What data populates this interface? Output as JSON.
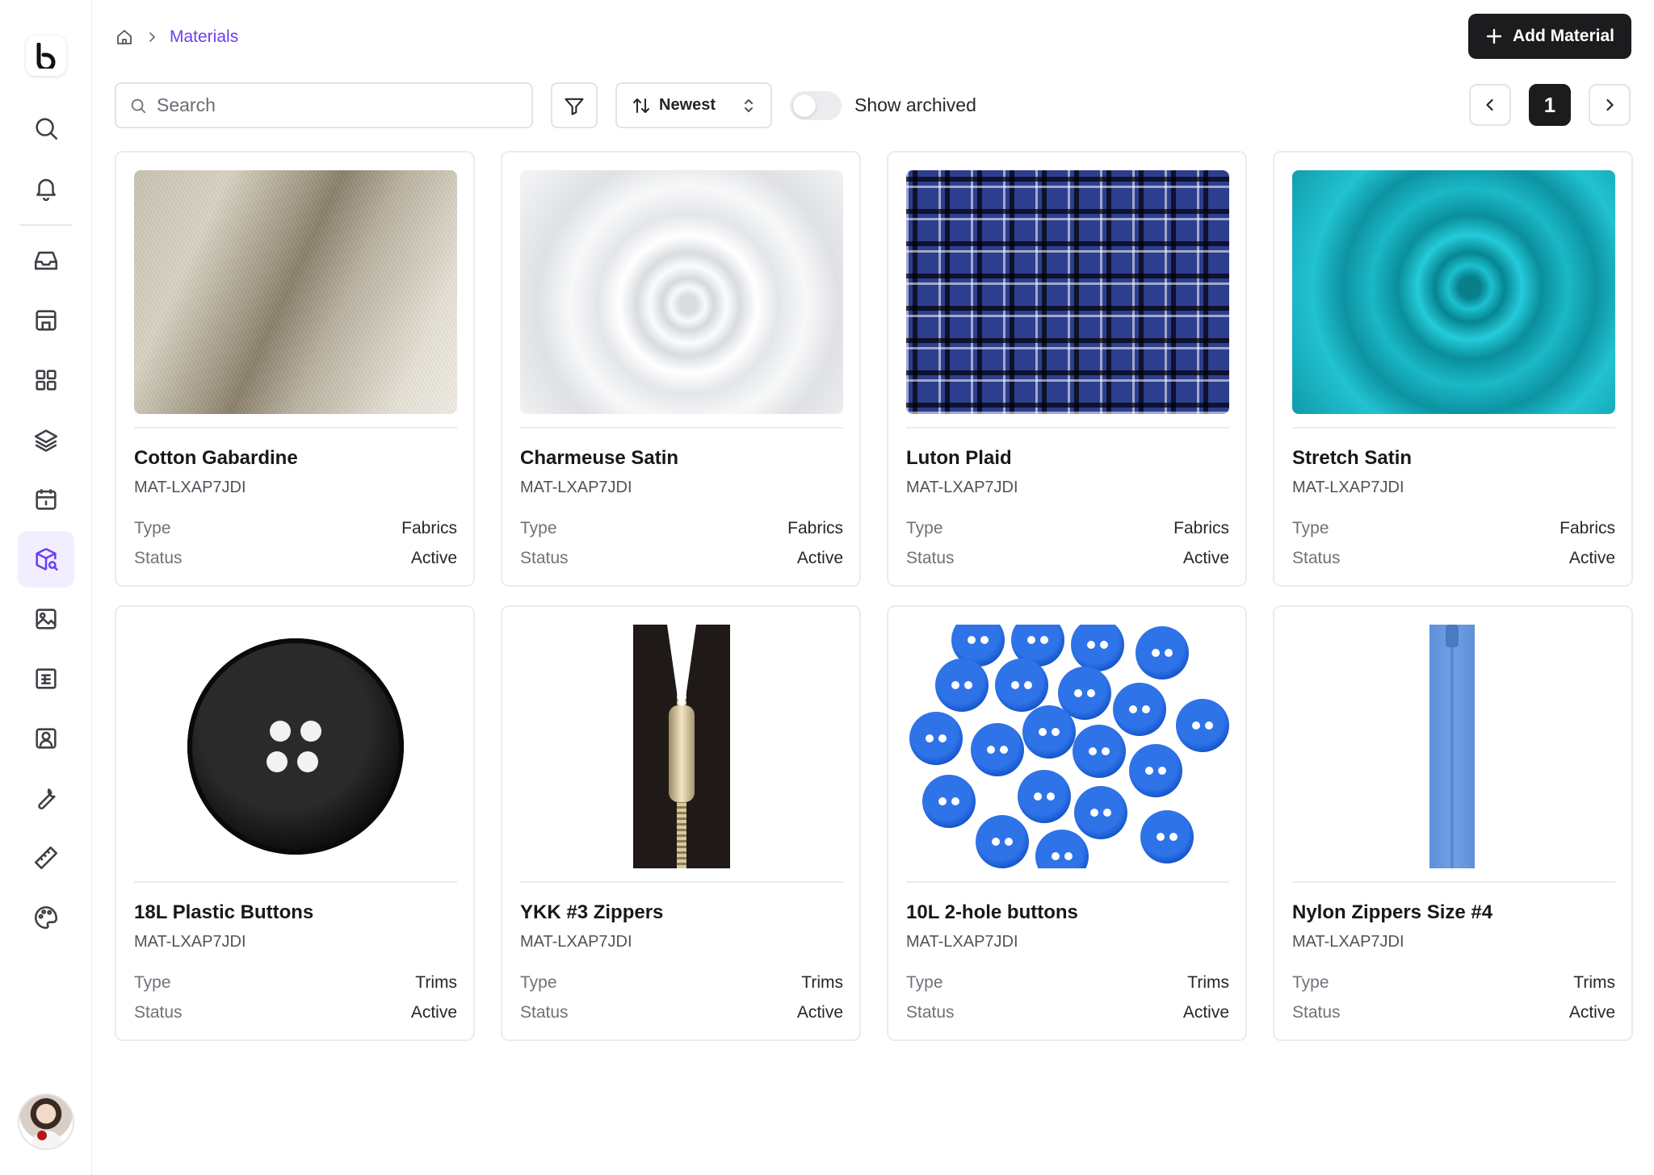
{
  "breadcrumb": {
    "current": "Materials"
  },
  "header": {
    "add_button_label": "Add Material"
  },
  "toolbar": {
    "search_placeholder": "Search",
    "sort_label": "Newest",
    "show_archived_label": "Show archived",
    "show_archived_on": false
  },
  "pagination": {
    "current_page": "1"
  },
  "sidebar": {
    "items": [
      "search",
      "notifications",
      "inbox",
      "store",
      "dashboard",
      "layers",
      "calendar",
      "materials",
      "images",
      "reports",
      "contacts",
      "tools",
      "measurements",
      "palette"
    ],
    "active": "materials"
  },
  "labels": {
    "type": "Type",
    "status": "Status"
  },
  "materials": [
    {
      "name": "Cotton Gabardine",
      "code": "MAT-LXAP7JDI",
      "type": "Fabrics",
      "status": "Active"
    },
    {
      "name": "Charmeuse Satin",
      "code": "MAT-LXAP7JDI",
      "type": "Fabrics",
      "status": "Active"
    },
    {
      "name": "Luton Plaid",
      "code": "MAT-LXAP7JDI",
      "type": "Fabrics",
      "status": "Active"
    },
    {
      "name": "Stretch Satin",
      "code": "MAT-LXAP7JDI",
      "type": "Fabrics",
      "status": "Active"
    },
    {
      "name": "18L Plastic Buttons",
      "code": "MAT-LXAP7JDI",
      "type": "Trims",
      "status": "Active"
    },
    {
      "name": "YKK #3 Zippers",
      "code": "MAT-LXAP7JDI",
      "type": "Trims",
      "status": "Active"
    },
    {
      "name": "10L 2-hole buttons",
      "code": "MAT-LXAP7JDI",
      "type": "Trims",
      "status": "Active"
    },
    {
      "name": "Nylon Zippers Size #4",
      "code": "MAT-LXAP7JDI",
      "type": "Trims",
      "status": "Active"
    }
  ],
  "colors": {
    "accent": "#6d3df5",
    "primary_button": "#1c1c1f",
    "active_nav_bg": "#f1efff"
  }
}
